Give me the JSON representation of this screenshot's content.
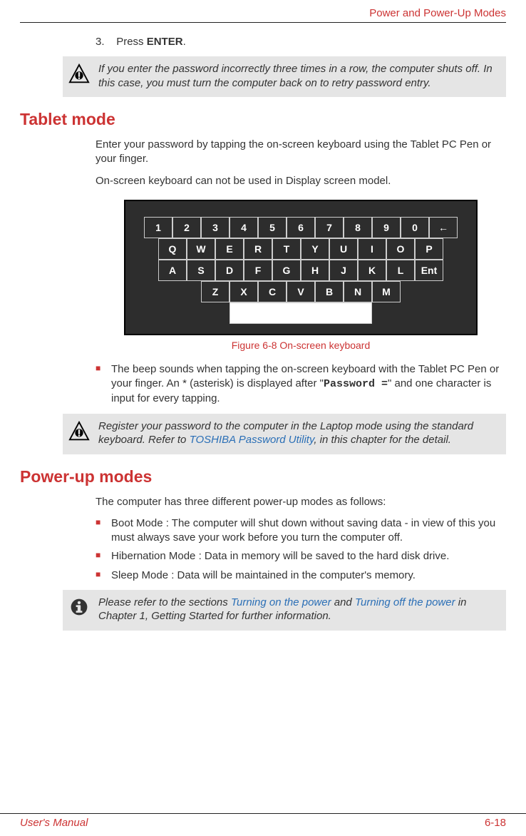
{
  "header": {
    "right": "Power and Power-Up Modes"
  },
  "step3": {
    "num": "3.",
    "pre": "Press ",
    "bold": "ENTER",
    "post": "."
  },
  "callout1": "If you enter the password incorrectly three times in a row, the computer shuts off. In this case, you must turn the computer back on to retry password entry.",
  "section_tablet": "Tablet mode",
  "tablet_p1": "Enter your password by tapping the on-screen keyboard using the Tablet PC Pen or your finger.",
  "tablet_p2": "On-screen keyboard can not be used in Display screen model.",
  "keyboard": {
    "row1": [
      "1",
      "2",
      "3",
      "4",
      "5",
      "6",
      "7",
      "8",
      "9",
      "0",
      "←"
    ],
    "row2": [
      "Q",
      "W",
      "E",
      "R",
      "T",
      "Y",
      "U",
      "I",
      "O",
      "P"
    ],
    "row3": [
      "A",
      "S",
      "D",
      "F",
      "G",
      "H",
      "J",
      "K",
      "L",
      "Ent"
    ],
    "row4": [
      "Z",
      "X",
      "C",
      "V",
      "B",
      "N",
      "M"
    ]
  },
  "fig_caption": "Figure 6-8 On-screen keyboard",
  "bullet_beep_pre": "The beep sounds when tapping the on-screen keyboard with the Tablet PC Pen or your finger. An * (asterisk) is displayed after \"",
  "bullet_beep_mono": "Password =",
  "bullet_beep_post": "\" and one character is input for every tapping.",
  "callout2_pre": "Register your password to the computer in the Laptop mode using the standard keyboard. Refer to ",
  "callout2_link": "TOSHIBA Password Utility",
  "callout2_post": ", in this chapter for the detail.",
  "section_power": "Power-up modes",
  "power_p1": "The computer has three different power-up modes as follows:",
  "power_bullets": [
    "Boot Mode : The computer will shut down without saving data - in view of this you must always save your work before you turn the computer off.",
    "Hibernation Mode : Data in memory will be saved to the hard disk drive.",
    "Sleep Mode : Data will be maintained in the computer's memory."
  ],
  "callout3_pre": "Please refer to the sections ",
  "callout3_link1": "Turning on the power",
  "callout3_mid": " and ",
  "callout3_link2": "Turning off the power",
  "callout3_post": " in Chapter 1, Getting Started for further information.",
  "footer": {
    "left": "User's Manual",
    "right": "6-18"
  }
}
